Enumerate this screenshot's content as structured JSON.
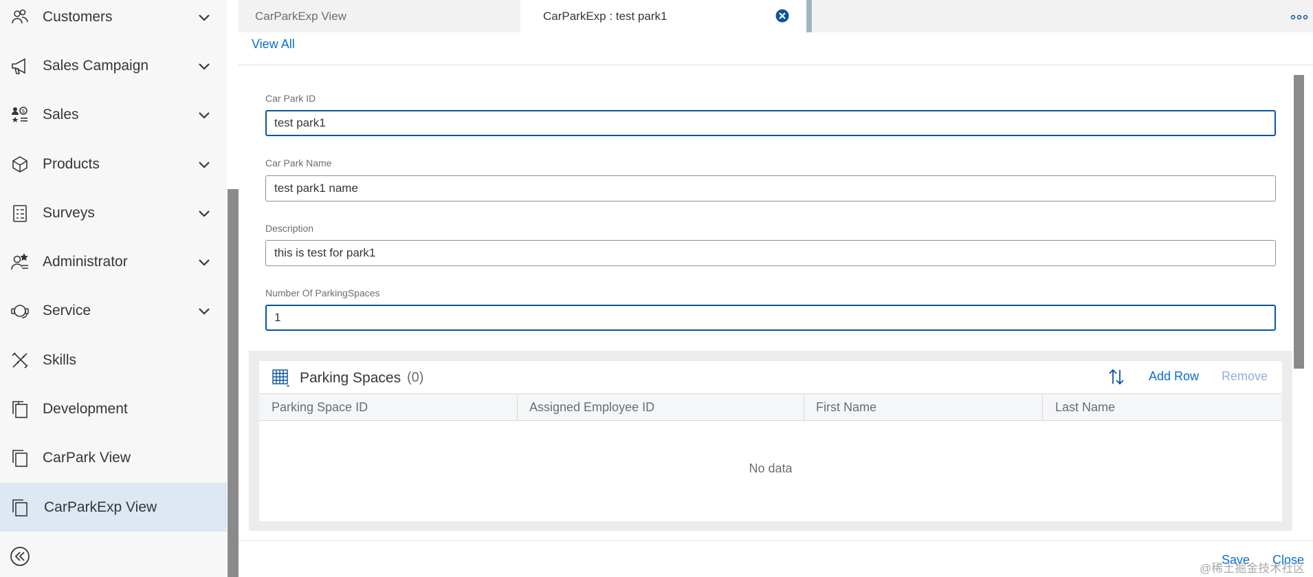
{
  "sidebar": {
    "items": [
      {
        "label": "Customers",
        "icon": "customers-icon"
      },
      {
        "label": "Sales Campaign",
        "icon": "megaphone-icon"
      },
      {
        "label": "Sales",
        "icon": "sales-icon"
      },
      {
        "label": "Products",
        "icon": "products-icon"
      },
      {
        "label": "Surveys",
        "icon": "survey-icon"
      },
      {
        "label": "Administrator",
        "icon": "administrator-icon"
      },
      {
        "label": "Service",
        "icon": "service-icon"
      },
      {
        "label": "Skills",
        "icon": "skills-icon"
      },
      {
        "label": "Development",
        "icon": "copy-icon"
      },
      {
        "label": "CarPark View",
        "icon": "copy-icon"
      },
      {
        "label": "CarParkExp View",
        "icon": "copy-icon",
        "selected": true
      }
    ],
    "collapse_icon": "collapse-left-icon"
  },
  "tabs": [
    {
      "label": "CarParkExp View",
      "active": false
    },
    {
      "label": "CarParkExp : test park1",
      "active": true
    }
  ],
  "header": {
    "view_all": "View All"
  },
  "form": {
    "car_park_id": {
      "label": "Car Park ID",
      "value": "test park1"
    },
    "car_park_name": {
      "label": "Car Park Name",
      "value": "test park1 name"
    },
    "description": {
      "label": "Description",
      "value": "this is test for park1"
    },
    "number_of_parking_spaces": {
      "label": "Number Of ParkingSpaces",
      "value": "1"
    }
  },
  "table": {
    "title": "Parking Spaces",
    "count": "(0)",
    "add_row": "Add Row",
    "remove": "Remove",
    "columns": [
      "Parking Space ID",
      "Assigned Employee ID",
      "First Name",
      "Last Name"
    ],
    "empty_text": "No data"
  },
  "footer": {
    "save": "Save",
    "close": "Close"
  },
  "watermark": "@稀土掘金技术社区",
  "colors": {
    "accent": "#0a6ed1",
    "selected_nav": "#dee8f2",
    "focus_border": "#0854a0"
  }
}
